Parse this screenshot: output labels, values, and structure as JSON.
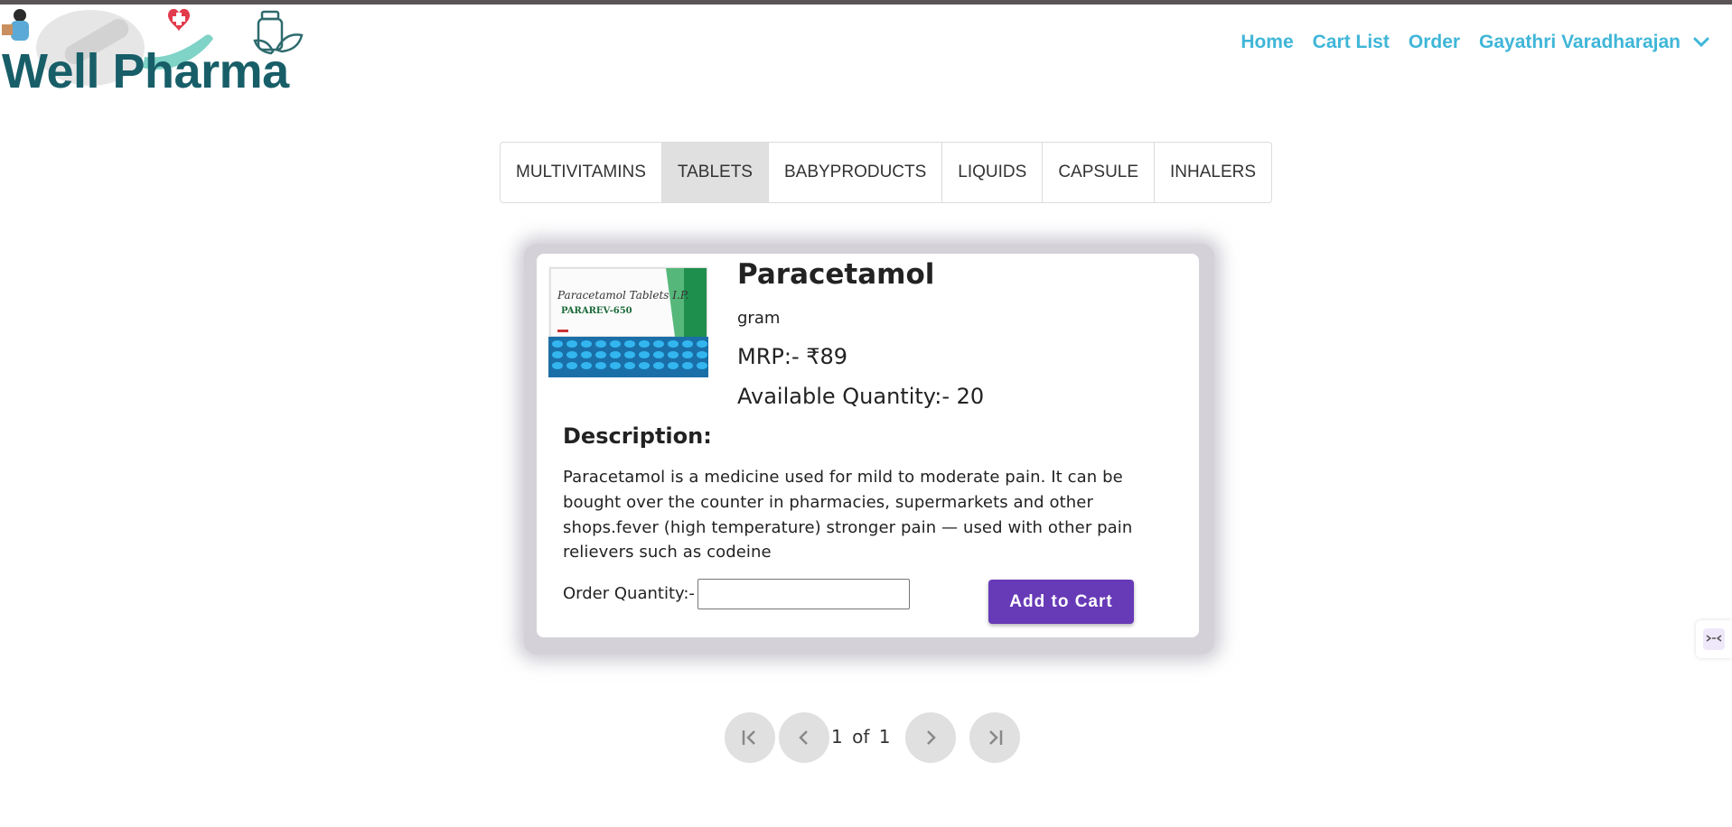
{
  "brand": {
    "name": "Well Pharma",
    "text_color": "#175e68"
  },
  "nav": {
    "items": [
      "Home",
      "Cart List",
      "Order"
    ],
    "user_name": "Gayathri Varadharajan",
    "color": "#3fb6d8"
  },
  "categories": {
    "tabs": [
      "MULTIVITAMINS",
      "TABLETS",
      "BABYPRODUCTS",
      "LIQUIDS",
      "CAPSULE",
      "INHALERS"
    ],
    "active": "TABLETS"
  },
  "product": {
    "name": "Paracetamol",
    "unit": "gram",
    "mrp": "MRP:- ₹89",
    "available": "Available Quantity:- 20",
    "description_heading": "Description:",
    "description": "Paracetamol is a medicine used for mild to moderate pain. It can be bought over the counter in pharmacies, supermarkets and other shops.fever (high temperature) stronger pain — used with other pain relievers such as codeine",
    "image_box_text": "Paracetamol Tablets I.P.",
    "image_brand": "PARAREV-650"
  },
  "order": {
    "quantity_label": "Order Quantity:-",
    "quantity_value": "",
    "add_to_cart_label": "Add to Cart",
    "button_color": "#673ab7"
  },
  "pagination": {
    "page_text": "1 of 1"
  }
}
